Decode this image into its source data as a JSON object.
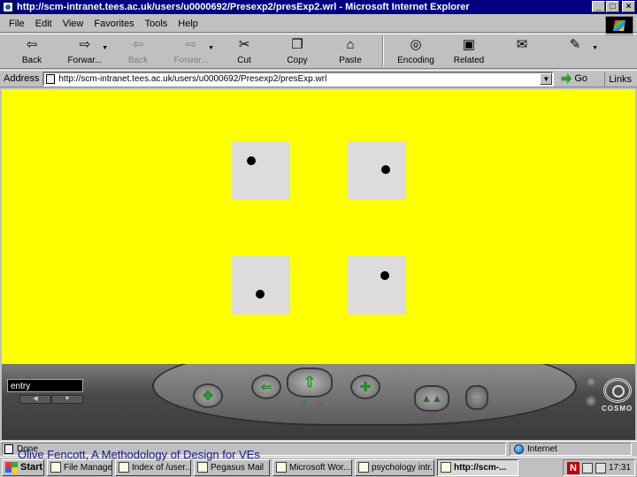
{
  "window": {
    "title": "http://scm-intranet.tees.ac.uk/users/u0000692/Presexp2/presExp2.wrl - Microsoft Internet Explorer",
    "controls": [
      "_",
      "□",
      "×"
    ]
  },
  "menu": [
    "File",
    "Edit",
    "View",
    "Favorites",
    "Tools",
    "Help"
  ],
  "toolbar": [
    {
      "label": "Back",
      "icon": "back-arrow-icon",
      "disabled": false
    },
    {
      "label": "Forwar...",
      "icon": "forward-arrow-icon",
      "disabled": false
    },
    {
      "label": "Back",
      "icon": "back-arrow-icon",
      "disabled": true
    },
    {
      "label": "Forwar...",
      "icon": "forward-arrow-icon",
      "disabled": true
    },
    {
      "label": "Cut",
      "icon": "cut-icon",
      "disabled": false
    },
    {
      "label": "Copy",
      "icon": "copy-icon",
      "disabled": false
    },
    {
      "label": "Paste",
      "icon": "paste-icon",
      "disabled": false
    },
    {
      "label": "Encoding",
      "icon": "encoding-icon",
      "disabled": false
    },
    {
      "label": "Related",
      "icon": "related-icon",
      "disabled": false
    }
  ],
  "address": {
    "label": "Address",
    "url": "http://scm-intranet.tees.ac.uk/users/u0000692/Presexp2/presExp.wrl",
    "go_label": "Go",
    "links_label": "Links"
  },
  "scene": {
    "background": "#ffff00",
    "tile_color": "#dcdcdc"
  },
  "player": {
    "viewpoint": "entry",
    "brand": "COSMO"
  },
  "status": {
    "text": "Done",
    "zone": "Internet"
  },
  "caption": "Olive Fencott, A Methodology of Design for VEs",
  "taskbar": {
    "start_label": "Start",
    "tasks": [
      {
        "label": "File Manager - ...",
        "active": false
      },
      {
        "label": "Index of /user...",
        "active": false
      },
      {
        "label": "Pegasus Mail",
        "active": false
      },
      {
        "label": "Microsoft Wor...",
        "active": false
      },
      {
        "label": "psychology intr...",
        "active": false
      },
      {
        "label": "http://scm-...",
        "active": true
      }
    ],
    "clock": "17:31"
  }
}
